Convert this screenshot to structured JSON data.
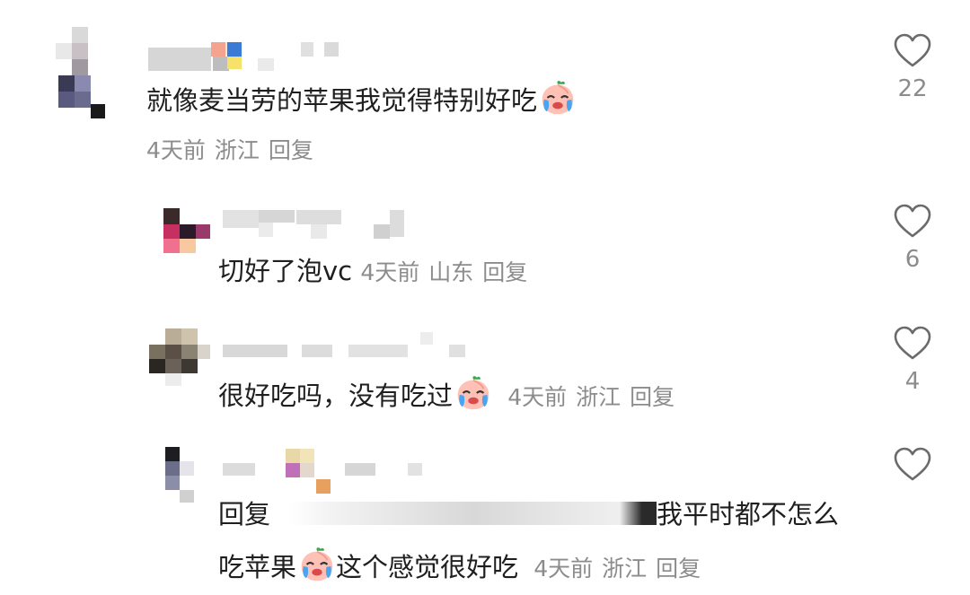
{
  "comments": [
    {
      "text": "就像麦当劳的苹果我觉得特别好吃",
      "emoji": "crying-peach-emoji",
      "time": "4天前",
      "location": "浙江",
      "reply_label": "回复",
      "likes": "22"
    },
    {
      "text": "切好了泡vc",
      "time": "4天前",
      "location": "山东",
      "reply_label": "回复",
      "likes": "6"
    },
    {
      "text": "很好吃吗，没有吃过",
      "emoji": "crying-peach-emoji",
      "time": "4天前",
      "location": "浙江",
      "reply_label": "回复",
      "likes": "4"
    },
    {
      "reply_prefix": "回复",
      "text_line1": "我平时都不怎么",
      "text_line2_a": "吃苹果",
      "emoji": "crying-peach-emoji",
      "text_line2_b": "这个感觉很好吃",
      "time": "4天前",
      "location": "浙江",
      "reply_label": "回复",
      "likes": ""
    }
  ],
  "colors": {
    "text": "#1f1f1f",
    "meta": "#8c8c8c",
    "background": "#ffffff",
    "heart_outline": "#6b6b6b"
  },
  "icons": [
    "heart-outline-icon",
    "crying-peach-emoji"
  ]
}
